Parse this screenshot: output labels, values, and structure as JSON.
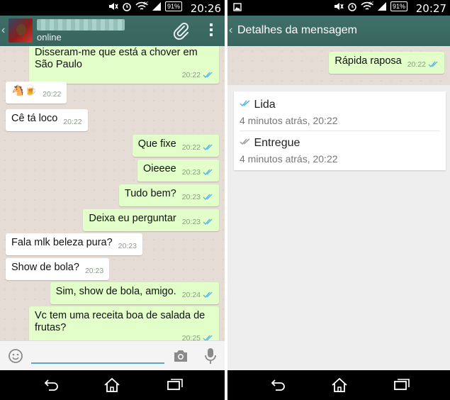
{
  "left_screen": {
    "status_bar": {
      "time": "20:26",
      "battery": "91%",
      "network": "4G"
    },
    "header": {
      "contact_status": "online"
    },
    "messages": [
      {
        "dir": "out",
        "text": "Disseram-me que está a chover em São Paulo",
        "time": "20:22",
        "read": true
      },
      {
        "dir": "in",
        "text": "🐴🍺",
        "time": "20:22"
      },
      {
        "dir": "in",
        "text": "Cê tá loco",
        "time": "20:22"
      },
      {
        "dir": "out",
        "text": "Que fixe",
        "time": "20:22",
        "read": true
      },
      {
        "dir": "out",
        "text": "Oieeee",
        "time": "20:23",
        "read": true
      },
      {
        "dir": "out",
        "text": "Tudo bem?",
        "time": "20:23",
        "read": true
      },
      {
        "dir": "out",
        "text": "Deixa eu perguntar",
        "time": "20:23",
        "read": true
      },
      {
        "dir": "in",
        "text": "Fala mlk beleza pura?",
        "time": "20:23"
      },
      {
        "dir": "in",
        "text": "Show de bola?",
        "time": "20:23"
      },
      {
        "dir": "out",
        "text": "Sim, show de bola, amigo.",
        "time": "20:24",
        "read": true
      },
      {
        "dir": "out",
        "text": "Vc tem uma receita boa de salada de frutas?",
        "time": "20:25",
        "read": true
      }
    ],
    "input": {
      "value": "",
      "placeholder": ""
    }
  },
  "right_screen": {
    "status_bar": {
      "time": "20:27",
      "battery": "91%",
      "network": "4G"
    },
    "header": {
      "title": "Detalhes da mensagem"
    },
    "message": {
      "text": "Rápida raposa",
      "time": "20:22"
    },
    "details": [
      {
        "label": "Lida",
        "sub": "4 minutos atrás, 20:22",
        "tick_color": "#5ab4e5"
      },
      {
        "label": "Entregue",
        "sub": "4 minutos atrás, 20:22",
        "tick_color": "#9e9e9e"
      }
    ]
  },
  "colors": {
    "header": "#3b6b64",
    "outgoing_bubble": "#e2fec9",
    "incoming_bubble": "#ffffff",
    "read_ticks": "#5ab4e5",
    "chat_background": "#e5ddd5"
  }
}
